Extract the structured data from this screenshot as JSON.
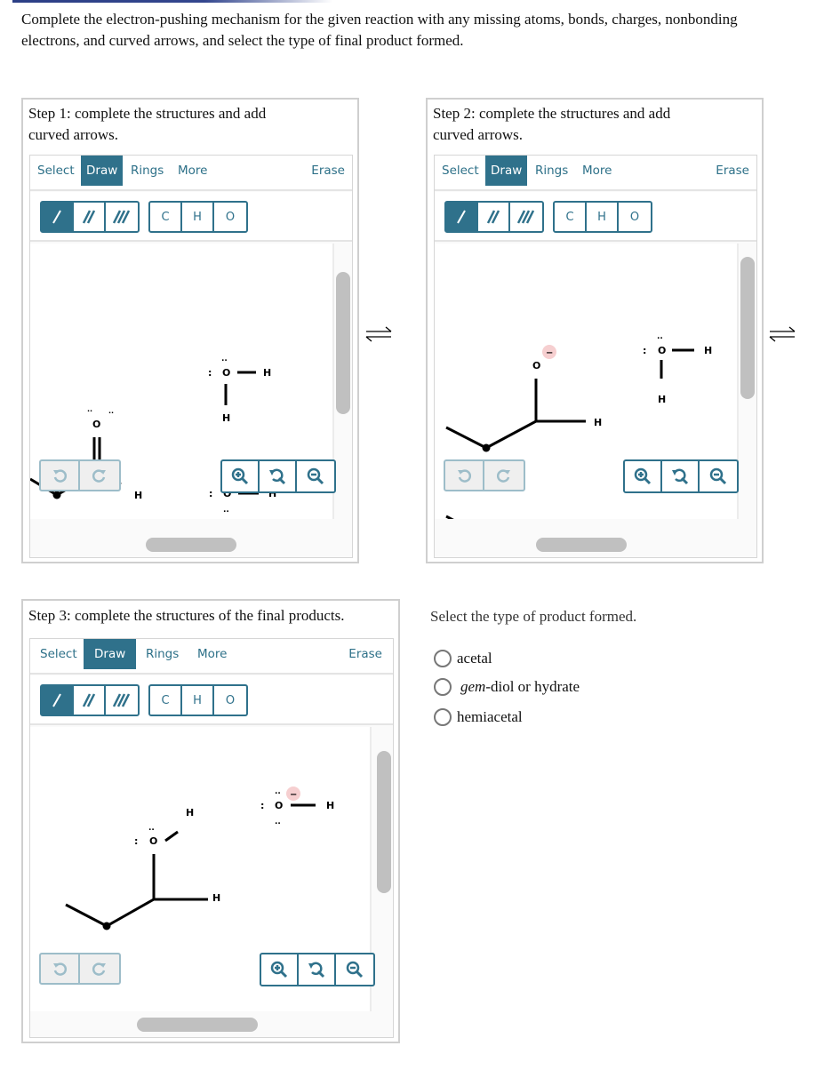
{
  "prompt": "Complete the electron-pushing mechanism for the given reaction with any missing atoms, bonds, charges, nonbonding electrons, and curved arrows, and select the type of final product formed.",
  "editor_tabs": {
    "select": "Select",
    "draw": "Draw",
    "rings": "Rings",
    "more": "More",
    "erase": "Erase"
  },
  "atom_buttons": [
    "C",
    "H",
    "O"
  ],
  "bond_buttons": [
    "single-bond",
    "double-bond",
    "triple-bond"
  ],
  "steps": [
    {
      "title": "Step 1: complete the structures and add curved arrows."
    },
    {
      "title": "Step 2: complete the structures and add curved arrows."
    },
    {
      "title": "Step 3: complete the structures of the final products."
    }
  ],
  "labels": {
    "O": "O",
    "H": "H",
    "minus": "−",
    "lp_v": ":",
    "lp_h": "··"
  },
  "equilibrium_symbol": "⇌",
  "question": {
    "prompt": "Select the type of product formed.",
    "options": [
      {
        "label": "acetal",
        "selected": false
      },
      {
        "italic": "gem",
        "label": "-diol or hydrate",
        "selected": false
      },
      {
        "label": "hemiacetal",
        "selected": false
      }
    ]
  },
  "colors": {
    "accent": "#2f718b",
    "charge_bg": "#f6cfd0",
    "disabled": "#9dbdc9"
  }
}
